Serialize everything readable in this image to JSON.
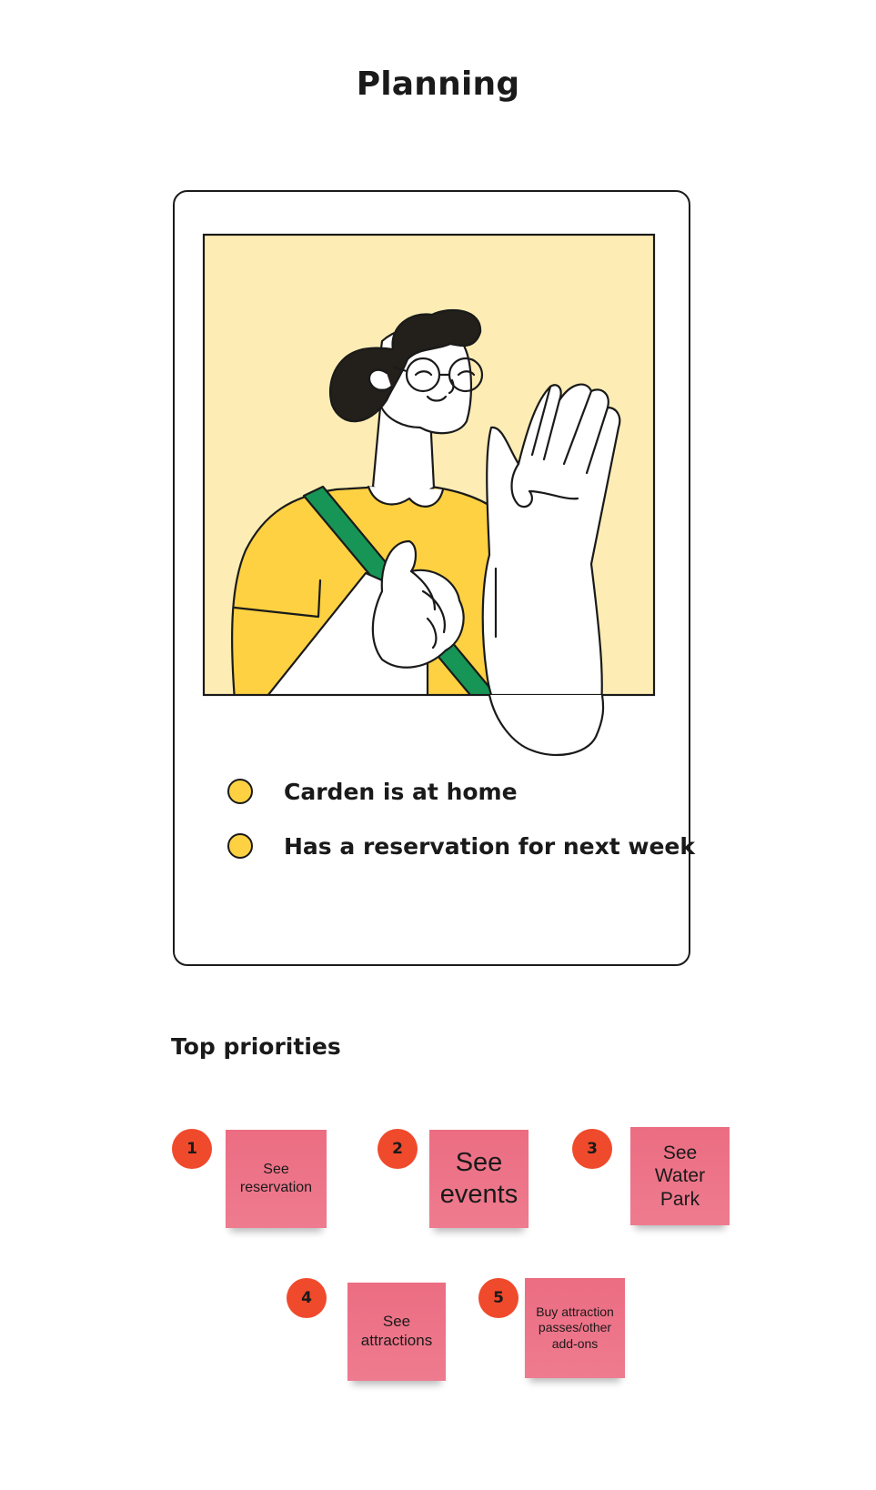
{
  "page": {
    "title": "Planning"
  },
  "persona": {
    "facts": [
      "Carden is at home",
      "Has a reservation for next week"
    ],
    "colors": {
      "background": "#fdedb5",
      "shirt": "#fdd142",
      "strap": "#169556",
      "hair": "#231f1a",
      "dot": "#fdd142"
    }
  },
  "priorities": {
    "title": "Top priorities",
    "items": [
      {
        "number": "1",
        "label": "See reservation"
      },
      {
        "number": "2",
        "label": "See events"
      },
      {
        "number": "3",
        "label": "See Water Park"
      },
      {
        "number": "4",
        "label": "See attractions"
      },
      {
        "number": "5",
        "label": "Buy attraction passes/other add-ons"
      }
    ]
  },
  "colors": {
    "badge": "#ef4a2c",
    "sticky": "#ee7387"
  }
}
